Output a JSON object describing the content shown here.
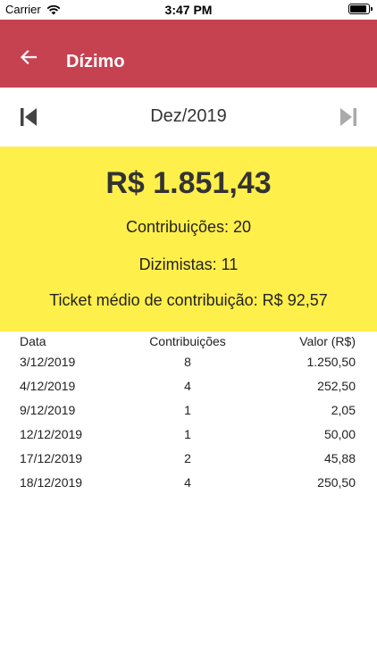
{
  "status_bar": {
    "carrier": "Carrier",
    "time": "3:47 PM"
  },
  "app_bar": {
    "title": "Dízimo",
    "color": "#c64250"
  },
  "month_nav": {
    "month": "Dez/2019"
  },
  "summary": {
    "total": "R$ 1.851,43",
    "contributions": "Contribuições: 20",
    "tithers": "Dizimistas: 11",
    "average_ticket": "Ticket médio de contribuição: R$ 92,57",
    "color": "#ffef4a"
  },
  "table": {
    "headers": {
      "date": "Data",
      "count": "Contribuições",
      "value": "Valor (R$)"
    },
    "rows": [
      {
        "date": "3/12/2019",
        "count": "8",
        "value": "1.250,50"
      },
      {
        "date": "4/12/2019",
        "count": "4",
        "value": "252,50"
      },
      {
        "date": "9/12/2019",
        "count": "1",
        "value": "2,05"
      },
      {
        "date": "12/12/2019",
        "count": "1",
        "value": "50,00"
      },
      {
        "date": "17/12/2019",
        "count": "2",
        "value": "45,88"
      },
      {
        "date": "18/12/2019",
        "count": "4",
        "value": "250,50"
      }
    ]
  }
}
